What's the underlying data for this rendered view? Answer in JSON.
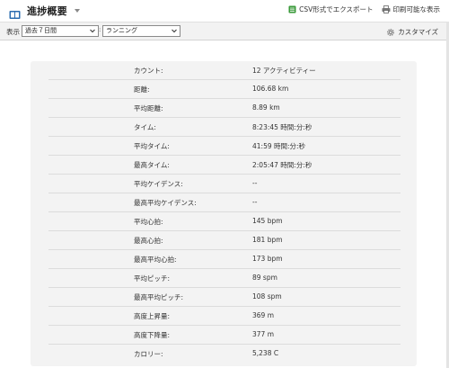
{
  "header": {
    "title": "進捗概要",
    "actions": {
      "export_csv": "CSV形式でエクスポート",
      "print": "印刷可能な表示"
    }
  },
  "toolbar": {
    "show_label": "表示",
    "period": "過去７日間",
    "separator": ":",
    "activity_type": "ランニング",
    "customize": "カスタマイズ"
  },
  "stats": [
    {
      "label": "カウント:",
      "value": "12 アクティビティー"
    },
    {
      "label": "距離:",
      "value": "106.68 km"
    },
    {
      "label": "平均距離:",
      "value": "8.89 km"
    },
    {
      "label": "タイム:",
      "value": "8:23:45 時間:分:秒"
    },
    {
      "label": "平均タイム:",
      "value": "41:59 時間:分:秒"
    },
    {
      "label": "最高タイム:",
      "value": "2:05:47 時間:分:秒"
    },
    {
      "label": "平均ケイデンス:",
      "value": "--"
    },
    {
      "label": "最高平均ケイデンス:",
      "value": "--"
    },
    {
      "label": "平均心拍:",
      "value": "145 bpm"
    },
    {
      "label": "最高心拍:",
      "value": "181 bpm"
    },
    {
      "label": "最高平均心拍:",
      "value": "173 bpm"
    },
    {
      "label": "平均ピッチ:",
      "value": "89 spm"
    },
    {
      "label": "最高平均ピッチ:",
      "value": "108 spm"
    },
    {
      "label": "高度上昇量:",
      "value": "369 m"
    },
    {
      "label": "高度下降量:",
      "value": "377 m"
    },
    {
      "label": "カロリー:",
      "value": "5,238 C"
    }
  ],
  "icons": {
    "title": "book-icon",
    "export_csv": "spreadsheet-icon",
    "print": "printer-icon",
    "customize": "gear-icon",
    "dropdown": "chevron-down-icon"
  },
  "colors": {
    "toolbar_bg": "#f2f2f2",
    "card_bg": "#f3f3f3",
    "book_icon": "#2b6cb0",
    "csv_icon": "#3a9a3a"
  }
}
